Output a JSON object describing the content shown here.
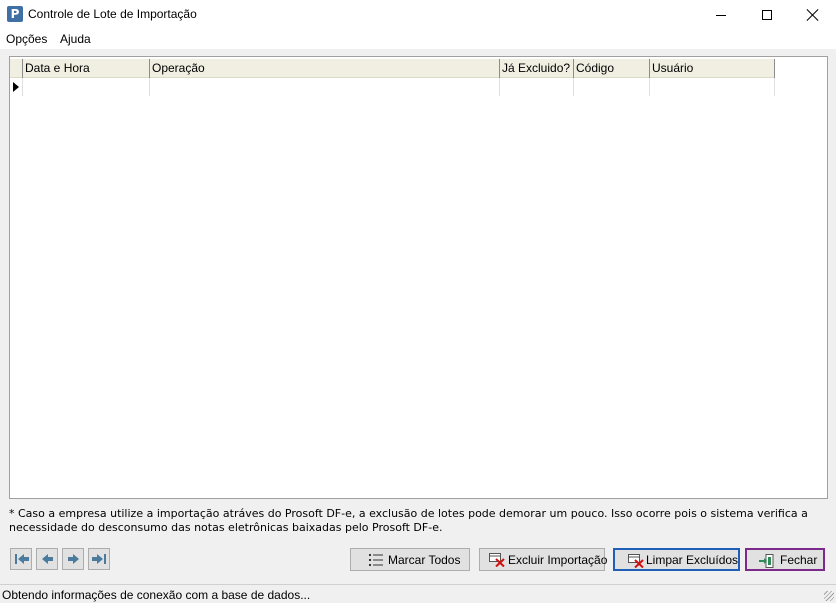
{
  "window": {
    "title": "Controle de Lote de Importação",
    "app_icon_letter": "P"
  },
  "menu": {
    "items": [
      "Opções",
      "Ajuda"
    ]
  },
  "grid": {
    "columns": [
      "Data e Hora",
      "Operação",
      "Já Excluido?",
      "Código",
      "Usuário"
    ],
    "rows": []
  },
  "note": "* Caso a empresa utilize a importação atráves do Prosoft DF-e, a exclusão de lotes pode demorar um pouco. Isso ocorre pois o sistema verifica a necessidade do desconsumo das notas eletrônicas baixadas pelo  Prosoft DF-e.",
  "buttons": {
    "marcar_todos": "Marcar Todos",
    "excluir_importacao": "Excluir Importação",
    "limpar_excluidos": "Limpar Excluídos",
    "fechar": "Fechar"
  },
  "status": {
    "text": "Obtendo informações de conexão com a base de dados..."
  },
  "colors": {
    "grid_header_bg": "#f1efe2",
    "limpar_focus_border": "#1f5fb8",
    "fechar_border": "#7b2a8c",
    "nav_arrow": "#4a7b9d"
  }
}
